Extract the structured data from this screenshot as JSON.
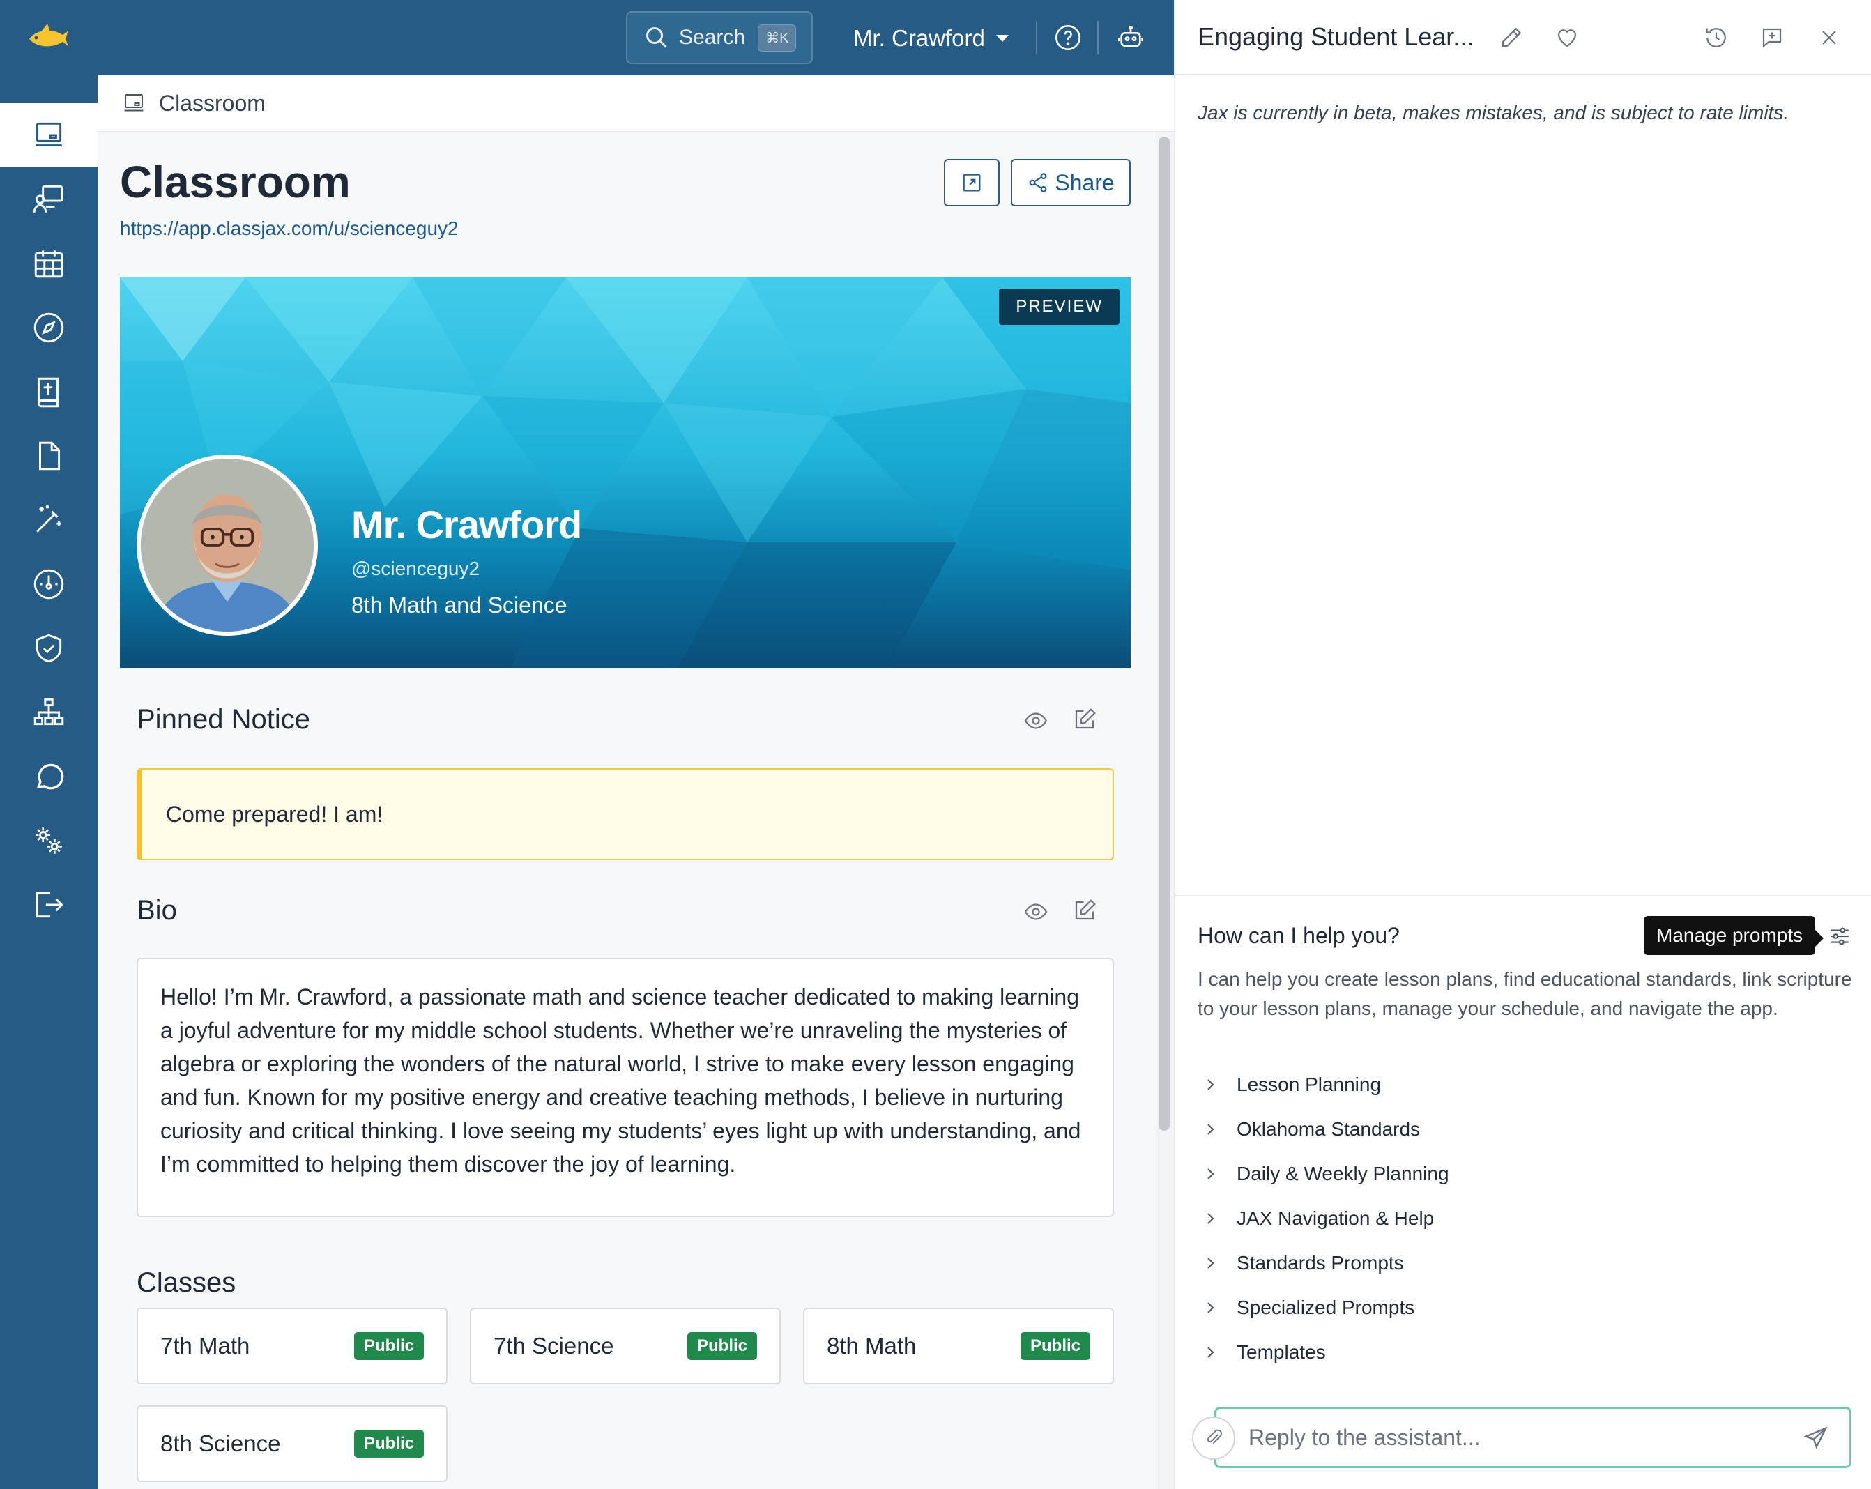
{
  "topbar": {
    "search_label": "Search",
    "search_shortcut": "⌘K",
    "user_name": "Mr. Crawford",
    "brand_color": "#255b85",
    "icons": [
      "help-circle-icon",
      "robot-icon"
    ]
  },
  "sidebar": {
    "items": [
      {
        "name": "classroom",
        "icon": "monitor-icon",
        "active": true
      },
      {
        "name": "teacher",
        "icon": "presentation-icon"
      },
      {
        "name": "calendar",
        "icon": "calendar-icon"
      },
      {
        "name": "explore",
        "icon": "compass-icon"
      },
      {
        "name": "bible",
        "icon": "bible-icon"
      },
      {
        "name": "documents",
        "icon": "document-icon"
      },
      {
        "name": "ai-tools",
        "icon": "magic-wand-icon"
      },
      {
        "name": "dashboard",
        "icon": "gauge-icon"
      },
      {
        "name": "security",
        "icon": "shield-check-icon"
      },
      {
        "name": "organization",
        "icon": "sitemap-icon"
      },
      {
        "name": "chat",
        "icon": "chat-bubble-icon"
      },
      {
        "name": "settings",
        "icon": "gears-icon"
      },
      {
        "name": "sign-out",
        "icon": "sign-out-icon"
      }
    ]
  },
  "breadcrumb": {
    "label": "Classroom"
  },
  "page": {
    "title": "Classroom",
    "url": "https://app.classjax.com/u/scienceguy2",
    "share_label": "Share"
  },
  "banner": {
    "preview_label": "PREVIEW",
    "name": "Mr. Crawford",
    "handle": "@scienceguy2",
    "subtitle": "8th Math and Science"
  },
  "pinned": {
    "title": "Pinned Notice",
    "text": "Come prepared! I am!"
  },
  "bio": {
    "title": "Bio",
    "text": "Hello! I’m Mr. Crawford, a passionate math and science teacher dedicated to making learning a joyful adventure for my middle school students. Whether we’re unraveling the mysteries of algebra or exploring the wonders of the natural world, I strive to make every lesson engaging and fun. Known for my positive energy and creative teaching methods, I believe in nurturing curiosity and critical thinking. I love seeing my students’ eyes light up with understanding, and I’m committed to helping them discover the joy of learning."
  },
  "classes": {
    "title": "Classes",
    "items": [
      {
        "name": "7th Math",
        "badge": "Public"
      },
      {
        "name": "7th Science",
        "badge": "Public"
      },
      {
        "name": "8th Math",
        "badge": "Public"
      },
      {
        "name": "8th Science",
        "badge": "Public"
      }
    ],
    "badge_color": "#1f8a4c"
  },
  "assistant": {
    "title": "Engaging Student Lear...",
    "beta_note": "Jax is currently in beta, makes mistakes, and is subject to rate limits.",
    "help_title": "How can I help you?",
    "manage_prompts": "Manage prompts",
    "help_desc": "I can help you create lesson plans, find educational standards, link scripture to your lesson plans, manage your schedule, and navigate the app.",
    "prompts": [
      "Lesson Planning",
      "Oklahoma Standards",
      "Daily & Weekly Planning",
      "JAX Navigation & Help",
      "Standards Prompts",
      "Specialized Prompts",
      "Templates"
    ],
    "reply_placeholder": "Reply to the assistant..."
  }
}
